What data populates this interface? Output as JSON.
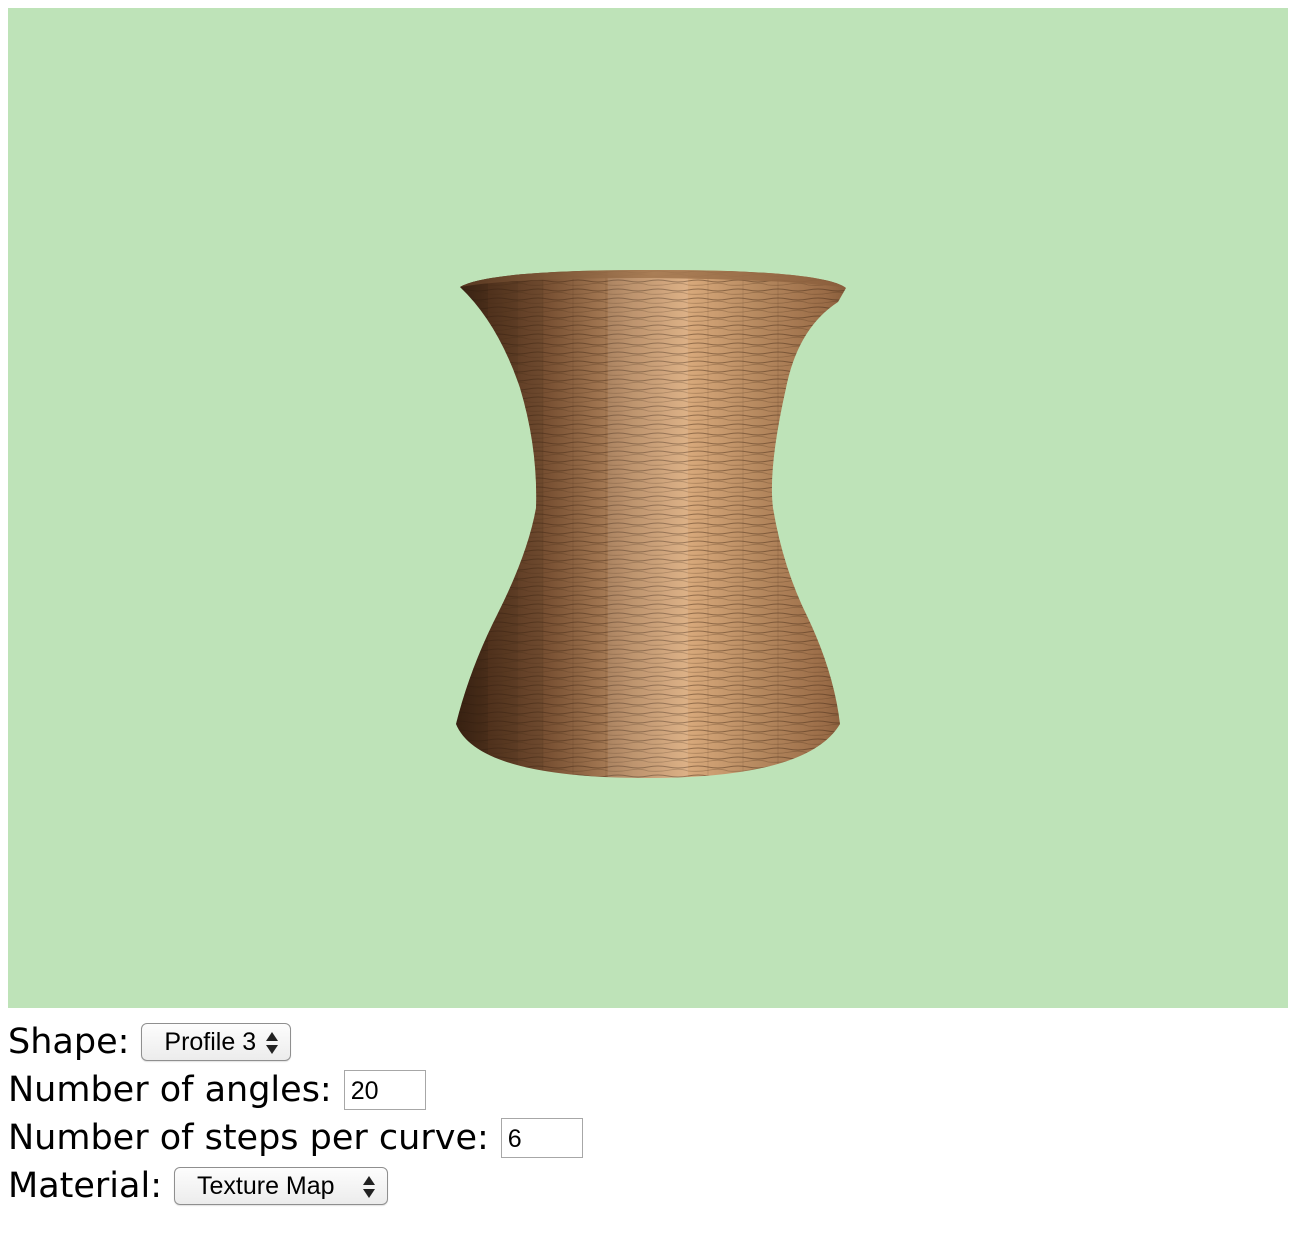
{
  "scene": {
    "background_color": "#bee3b8",
    "object": "vase-texture-mapped",
    "material_color": "#a87850"
  },
  "controls": {
    "shape": {
      "label": "Shape:",
      "value": "Profile 3"
    },
    "angles": {
      "label": "Number of angles:",
      "value": "20"
    },
    "steps": {
      "label": "Number of steps per curve:",
      "value": "6"
    },
    "material": {
      "label": "Material:",
      "value": "Texture Map"
    }
  }
}
